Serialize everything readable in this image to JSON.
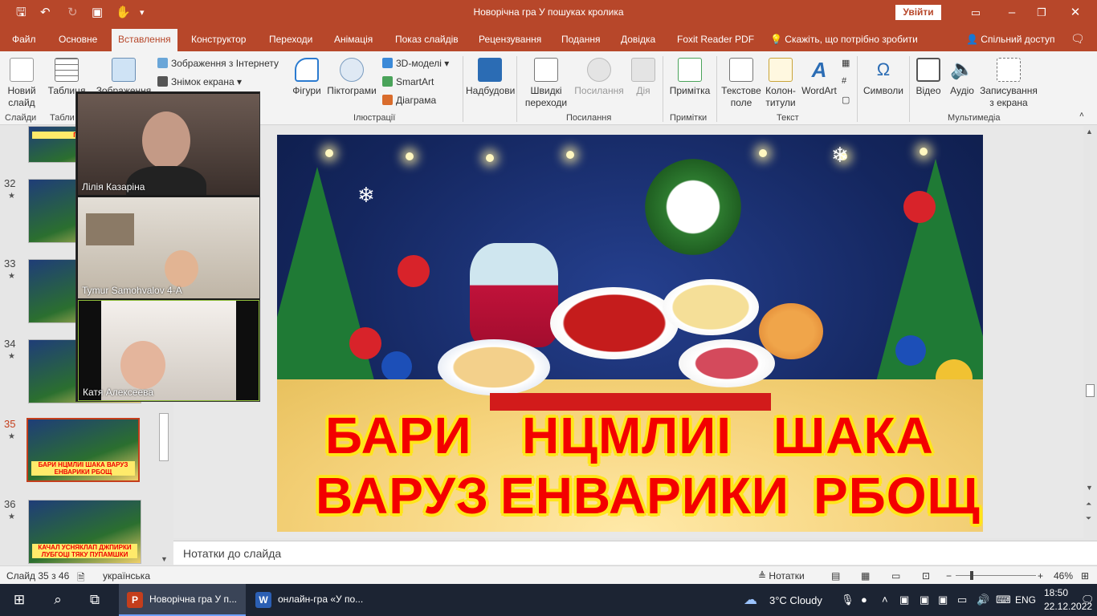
{
  "app": {
    "title": "Новорічна гра У пошуках кролика",
    "signin": "Увійти",
    "quick_access": [
      "save-icon",
      "undo-icon",
      "redo-icon",
      "present-icon",
      "touch-icon",
      "customize-icon"
    ]
  },
  "tabs": [
    "Файл",
    "Основне",
    "Вставлення",
    "Конструктор",
    "Переходи",
    "Анімація",
    "Показ слайдів",
    "Рецензування",
    "Подання",
    "Довідка",
    "Foxit Reader PDF"
  ],
  "active_tab": "Вставлення",
  "tell_me": "Скажіть, що потрібно зробити",
  "share": "Спільний доступ",
  "ribbon": {
    "new_slide": "Новий слайд",
    "table": "Таблиця",
    "images": "Зображення",
    "online_images": "Зображення з Інтернету",
    "screenshot": "Знімок екрана",
    "shapes": "Фігури",
    "icons": "Піктограми",
    "models_3d": "3D-моделі",
    "smartart": "SmartArt",
    "chart": "Діаграма",
    "addins": "Надбудови",
    "quick_transitions": "Швидкі переходи",
    "link": "Посилання",
    "action": "Дія",
    "comment": "Примітка",
    "textbox": "Текстове поле",
    "header_footer": "Колон-титули",
    "wordart": "WordArt",
    "symbols": "Символи",
    "video": "Відео",
    "audio": "Аудіо",
    "screen_recording": "Записування з екрана",
    "groups": {
      "slides": "Слайди",
      "tables": "Табли",
      "illustrations": "Ілюстрації",
      "links": "Посилання",
      "comments": "Примітки",
      "text": "Текст",
      "media": "Мультимедіа"
    }
  },
  "slides": [
    {
      "num": "",
      "title": "ПЕРЕ..."
    },
    {
      "num": "32",
      "title": ""
    },
    {
      "num": "33",
      "title": ""
    },
    {
      "num": "34",
      "title": ""
    },
    {
      "num": "35",
      "title": "БАРИ НЦМЛИІ ШАКА ВАРУЗ ЕНВАРИКИ РБОЩ"
    },
    {
      "num": "36",
      "title": "КАЧАЛ УСНЯКЛАП ДЖПИРКИ ЛУБГОЦІ ТЯКУ ПУПАМШКИ"
    }
  ],
  "current_slide_num": "35",
  "participants": [
    {
      "name": "Лілія Казаріна"
    },
    {
      "name": "Tymur Samohvalov 4-А"
    },
    {
      "name": "Катя Алексеева"
    }
  ],
  "slide_main": {
    "line1": [
      "БАРИ",
      "НЦМЛИІ",
      "ШАКА"
    ],
    "line2": [
      "ВАРУЗ",
      "ЕНВАРИКИ",
      "РБОЩ"
    ]
  },
  "notes_placeholder": "Нотатки до слайда",
  "status": {
    "slide_counter": "Слайд 35 з 46",
    "language": "українська",
    "notes_btn": "Нотатки",
    "zoom": "46%"
  },
  "taskbar": {
    "apps": [
      {
        "label": "Новорічна гра У п...",
        "icon": "P",
        "color": "#c43e1c"
      },
      {
        "label": "онлайн-гра «У по...",
        "icon": "W",
        "color": "#2b5fb4"
      }
    ],
    "weather": "3°C  Cloudy",
    "lang": "ENG",
    "time": "18:50",
    "date": "22.12.2022"
  }
}
